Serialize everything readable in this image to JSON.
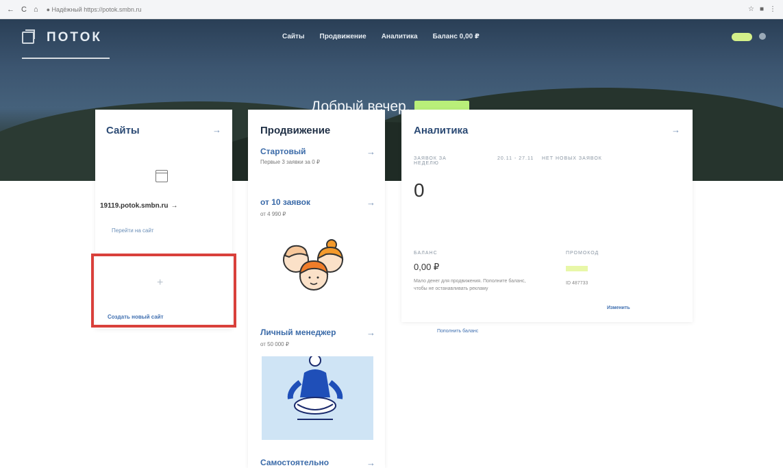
{
  "browser": {
    "address": "● Надёжный  https://potok.smbn.ru",
    "nav": [
      "←",
      "C",
      "⌂"
    ],
    "right_icons": [
      "☆",
      "■",
      "⋮"
    ]
  },
  "header": {
    "logo": "ПОТОК",
    "nav": [
      "Сайты",
      "Продвижение",
      "Аналитика",
      "Баланс 0,00 ₽"
    ],
    "greeting": "Добрый вечер,"
  },
  "sites": {
    "title": "Сайты",
    "arrow": "→",
    "domain": "19119.potok.smbn.ru",
    "domain_arrow": "→",
    "link": "Перейти на сайт",
    "new_plus": "+",
    "new_label": "Создать новый сайт"
  },
  "promo": {
    "title": "Продвижение",
    "items": [
      {
        "name": "Стартовый",
        "sub": "Первые 3 заявки за 0 ₽",
        "arrow": "→"
      },
      {
        "name": "от 10 заявок",
        "sub": "от 4 990 ₽",
        "arrow": "→"
      },
      {
        "name": "Личный менеджер",
        "sub": "от 50 000 ₽",
        "arrow": "→"
      },
      {
        "name": "Самостоятельно",
        "sub": "",
        "arrow": "→"
      }
    ]
  },
  "analytics": {
    "title": "Аналитика",
    "arrow": "→",
    "leads_label": "Заявок за неделю",
    "date_range": "20.11 - 27.11",
    "no_new": "Нет новых заявок",
    "leads_count": "0",
    "balance_label": "Баланс",
    "balance_value": "0,00 ₽",
    "balance_desc": "Мало денег для продвижения. Пополните баланс, чтобы не останавливать рекламу",
    "promo_label": "Промокод",
    "id_text": "ID 487733",
    "change_label": "Изменить",
    "topup_label": "Пополнить баланс"
  },
  "colors": {
    "accent_blue": "#3a6aa8",
    "highlight_red": "#d9403b",
    "blur_green": "#b9ef79"
  }
}
